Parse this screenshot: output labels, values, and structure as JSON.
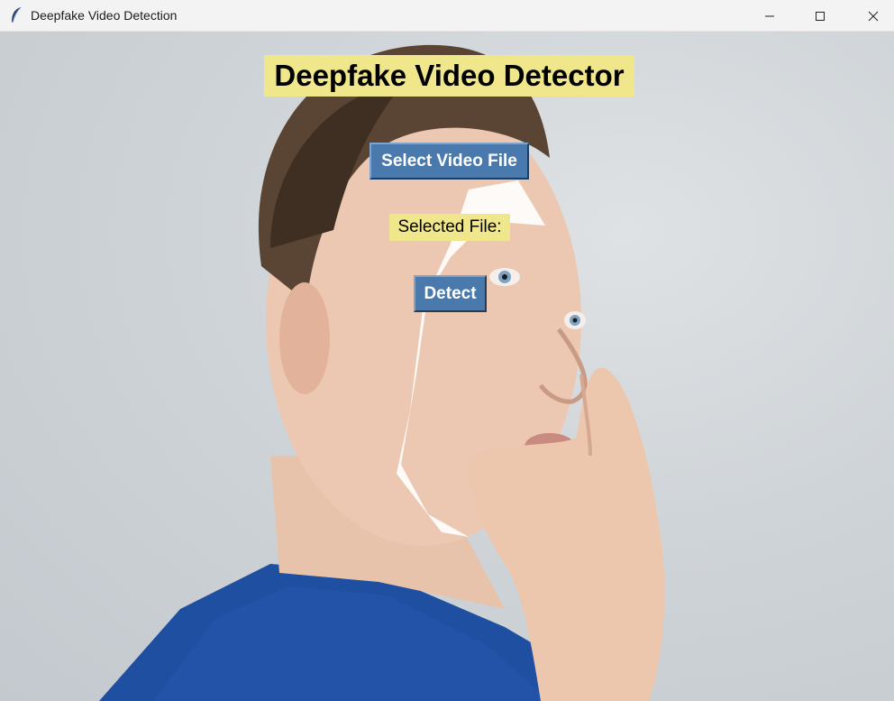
{
  "window": {
    "title": "Deepfake Video Detection"
  },
  "main": {
    "heading": "Deepfake Video Detector",
    "select_button_label": "Select Video File",
    "selected_file_label": "Selected File:",
    "detect_button_label": "Detect"
  },
  "colors": {
    "label_background": "#f0e68c",
    "button_background": "#4a7aad",
    "button_text": "#ffffff"
  },
  "icons": {
    "app": "feather-icon",
    "minimize": "minimize-icon",
    "maximize": "maximize-icon",
    "close": "close-icon"
  }
}
